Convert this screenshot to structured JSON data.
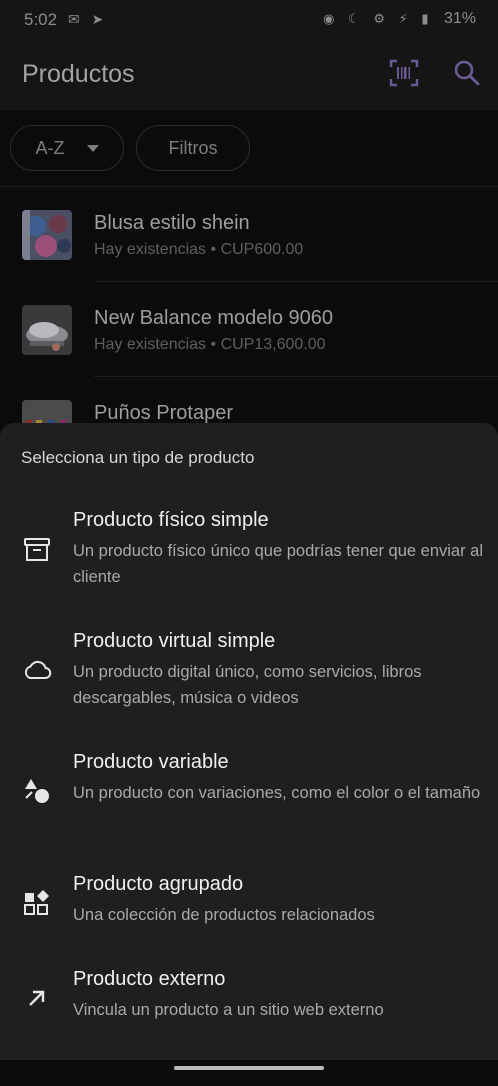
{
  "status_bar": {
    "time": "5:02",
    "battery": "31%"
  },
  "app_bar": {
    "title": "Productos",
    "icons": [
      "barcode-scan-icon",
      "search-icon"
    ],
    "accent_color": "#6b5a95"
  },
  "filters": {
    "sort_label": "A-Z",
    "filters_label": "Filtros"
  },
  "products": [
    {
      "name": "Blusa estilo shein",
      "stock": "Hay existencias",
      "separator": "•",
      "price": "CUP600.00"
    },
    {
      "name": "New Balance modelo 9060",
      "stock": "Hay existencias",
      "separator": "•",
      "price": "CUP13,600.00"
    },
    {
      "name": "Puños Protaper"
    }
  ],
  "sheet": {
    "title": "Selecciona un tipo de producto",
    "options": [
      {
        "icon": "archive-box-icon",
        "title": "Producto físico simple",
        "description": "Un producto físico único que podrías tener que enviar al cliente"
      },
      {
        "icon": "cloud-icon",
        "title": "Producto virtual simple",
        "description": "Un producto digital único, como servicios, libros descargables, música o videos"
      },
      {
        "icon": "shapes-icon",
        "title": "Producto variable",
        "description": "Un producto con variaciones, como el color o el tamaño"
      },
      {
        "icon": "widgets-icon",
        "title": "Producto agrupado",
        "description": "Una colección de productos relacionados"
      },
      {
        "icon": "arrow-up-right-icon",
        "title": "Producto externo",
        "description": "Vincula un producto a un sitio web externo"
      }
    ]
  }
}
